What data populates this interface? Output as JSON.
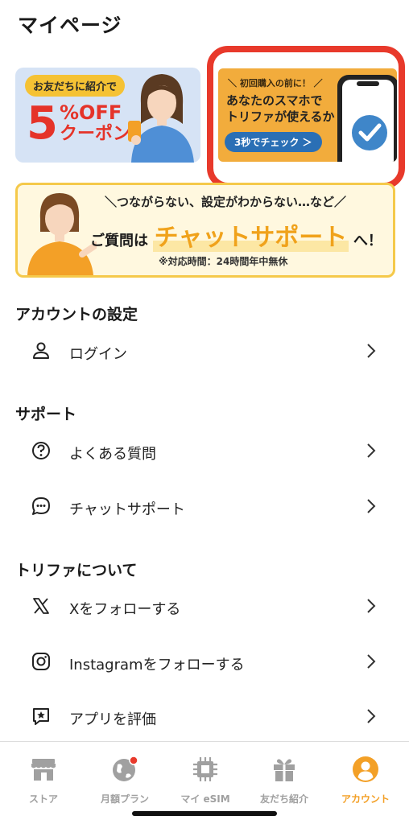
{
  "header": {
    "title": "マイページ"
  },
  "banners": {
    "referral": {
      "tag": "お友だちに紹介で",
      "number": "5",
      "off": "%OFF",
      "coupon": "クーポン"
    },
    "phone_check": {
      "sub": "＼ 初回購入の前に！ ／",
      "line1": "あなたのスマホで",
      "line2": "トリファが使えるか",
      "button": "3秒でチェック ＞"
    },
    "chat_support": {
      "top": "＼つながらない、設定がわからない…など／",
      "prefix": "ご質問は",
      "highlight": "チャットサポート",
      "suffix": "へ！",
      "hours": "※対応時間：24時間年中無休"
    }
  },
  "sections": {
    "account": {
      "title": "アカウントの設定",
      "items": [
        {
          "label": "ログイン",
          "icon": "person-icon"
        }
      ]
    },
    "support": {
      "title": "サポート",
      "items": [
        {
          "label": "よくある質問",
          "icon": "question-icon"
        },
        {
          "label": "チャットサポート",
          "icon": "chat-bubble-icon"
        }
      ]
    },
    "about": {
      "title": "トリファについて",
      "items": [
        {
          "label": "Xをフォローする",
          "icon": "x-logo-icon"
        },
        {
          "label": "Instagramをフォローする",
          "icon": "instagram-icon"
        },
        {
          "label": "アプリを評価",
          "icon": "star-review-icon"
        }
      ]
    }
  },
  "tabbar": {
    "items": [
      {
        "label": "ストア",
        "icon": "store-icon"
      },
      {
        "label": "月額プラン",
        "icon": "globe-icon"
      },
      {
        "label": "マイ eSIM",
        "icon": "chip-icon"
      },
      {
        "label": "友だち紹介",
        "icon": "gift-icon"
      },
      {
        "label": "アカウント",
        "icon": "account-icon"
      }
    ]
  },
  "colors": {
    "accent": "#f3a027",
    "highlight_border": "#e8392b",
    "coupon_red": "#e53329",
    "inactive": "#a0a0a0"
  }
}
